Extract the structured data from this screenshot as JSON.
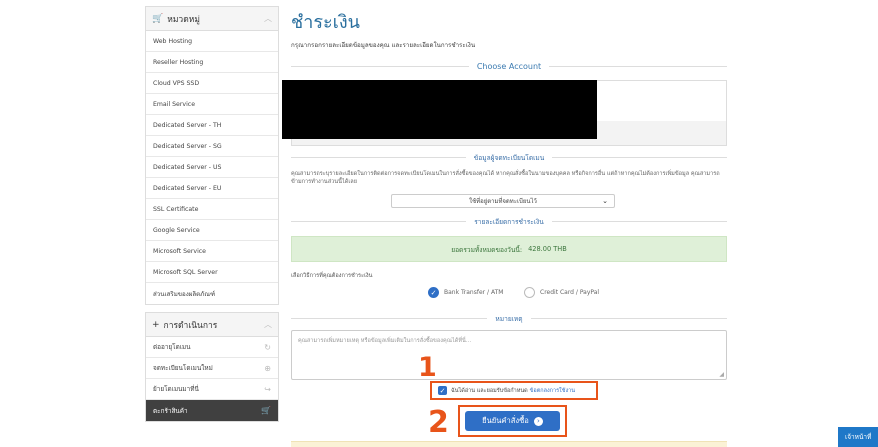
{
  "sidebar": {
    "categories_title": "หมวดหมู่",
    "categories": [
      "Web Hosting",
      "Reseller Hosting",
      "Cloud VPS SSD",
      "Email Service",
      "Dedicated Server - TH",
      "Dedicated Server - SG",
      "Dedicated Server - US",
      "Dedicated Server - EU",
      "SSL Certificate",
      "Google Service",
      "Microsoft Service",
      "Microsoft SQL Server",
      "ส่วนเสริมของผลิตภัณฑ์"
    ],
    "actions_title": "การดำเนินการ",
    "actions": [
      {
        "label": "ต่ออายุโดเมน",
        "icon": "refresh-icon"
      },
      {
        "label": "จดทะเบียนโดเมนใหม่",
        "icon": "globe-icon"
      },
      {
        "label": "ย้ายโดเมนมาที่นี่",
        "icon": "share-icon"
      },
      {
        "label": "ตะกร้าสินค้า",
        "icon": "cart-icon"
      }
    ]
  },
  "main": {
    "title": "ชำระเงิน",
    "subtitle": "กรุณากรอกรายละเอียดข้อมูลของคุณ และรายละเอียดในการชำระเงิน",
    "choose_account": "Choose Account",
    "registrant_heading": "ข้อมูลผู้จดทะเบียนโดเมน",
    "registrant_text": "คุณสามารถระบุรายละเอียดในการติดต่อการจดทะเบียนโดเมนในการสั่งซื้อของคุณได้ หากคุณสั่งซื้อในนามของบุคคล หรือกิจการอื่น แต่ถ้าหากคุณไม่ต้องการเพิ่มข้อมูล คุณสามารถข้ามการทำงานส่วนนี้ได้เลย",
    "registrant_select": "ใช้ที่อยู่ตามที่จดทะเบียนไว้",
    "payment_heading": "รายละเอียดการชำระเงิน",
    "total_label": "ยอดรวมทั้งหมดของวันนี้:",
    "total_amount": "428.00 THB",
    "payment_method_label": "เลือกวิธีการที่คุณต้องการชำระเงิน",
    "payment_options": [
      "Bank Transfer / ATM",
      "Credit Card / PayPal"
    ],
    "notes_heading": "หมายเหตุ",
    "notes_placeholder": "คุณสามารถเพิ่มหมายเหตุ หรือข้อมูลเพิ่มเติมในการสั่งซื้อของคุณได้ที่นี่...",
    "agree_text": "ฉันได้อ่าน และยอมรับข้อกำหนด",
    "agree_link": "ข้อตกลงการใช้งาน",
    "submit_label": "ยืนยันคำสั่งซื้อ",
    "marker_1": "1",
    "marker_2": "2"
  },
  "corner_button": "เจ้าหน้าที่"
}
